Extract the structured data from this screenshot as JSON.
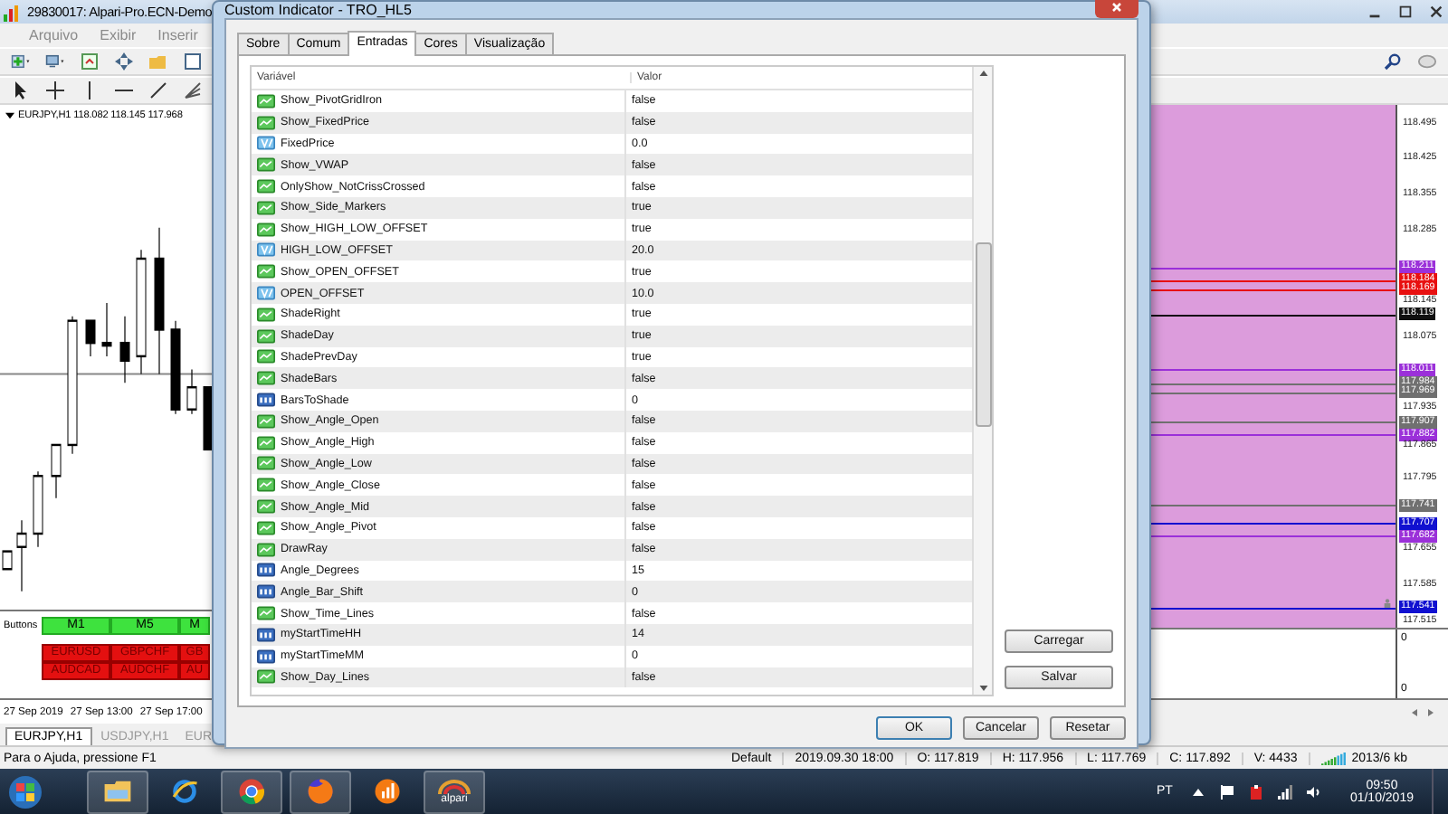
{
  "main_window": {
    "title": "29830017: Alpari-Pro.ECN-Demo",
    "menu": [
      "Arquivo",
      "Exibir",
      "Inserir"
    ]
  },
  "chart": {
    "label": "EURJPY,H1 118.082 118.145 117.968",
    "panel_label": "Buttons",
    "timeframe_buttons": [
      "M1",
      "M5",
      "M"
    ],
    "symbol_buttons": [
      "EURUSD",
      "GBPCHF",
      "GB",
      "AUDCAD",
      "AUDCHF",
      "AU"
    ],
    "time_labels": [
      "27 Sep 2019",
      "27 Sep 13:00",
      "27 Sep 17:00"
    ],
    "price_labels": [
      {
        "text": "118.495",
        "kind": "plain"
      },
      {
        "text": "118.425",
        "kind": "plain"
      },
      {
        "text": "118.355",
        "kind": "plain"
      },
      {
        "text": "118.285",
        "kind": "plain"
      },
      {
        "text": "118.211",
        "kind": "tag",
        "color": "#9b30d9"
      },
      {
        "text": "118.184",
        "kind": "tag",
        "color": "#e81010"
      },
      {
        "text": "118.169",
        "kind": "tag",
        "color": "#e81010"
      },
      {
        "text": "118.145",
        "kind": "plain"
      },
      {
        "text": "118.119",
        "kind": "tag",
        "color": "#101010"
      },
      {
        "text": "118.075",
        "kind": "plain"
      },
      {
        "text": "118.011",
        "kind": "tag",
        "color": "#9b30d9"
      },
      {
        "text": "117.984",
        "kind": "tag",
        "color": "#707070"
      },
      {
        "text": "117.969",
        "kind": "tag",
        "color": "#707070"
      },
      {
        "text": "117.935",
        "kind": "plain"
      },
      {
        "text": "117.907",
        "kind": "tag",
        "color": "#707070"
      },
      {
        "text": "117.882",
        "kind": "tag",
        "color": "#9b30d9"
      },
      {
        "text": "117.865",
        "kind": "plain"
      },
      {
        "text": "117.795",
        "kind": "plain"
      },
      {
        "text": "117.741",
        "kind": "tag",
        "color": "#707070"
      },
      {
        "text": "117.707",
        "kind": "tag",
        "color": "#1010d0"
      },
      {
        "text": "117.682",
        "kind": "tag",
        "color": "#9b30d9"
      },
      {
        "text": "117.655",
        "kind": "plain"
      },
      {
        "text": "117.585",
        "kind": "plain"
      },
      {
        "text": "117.541",
        "kind": "tag",
        "color": "#1010d0"
      },
      {
        "text": "117.515",
        "kind": "plain"
      }
    ],
    "subwindow_labels": [
      "0",
      "0"
    ]
  },
  "chart_tabs": [
    {
      "label": "EURJPY,H1",
      "selected": true
    },
    {
      "label": "USDJPY,H1",
      "selected": false
    },
    {
      "label": "EUR",
      "selected": false
    }
  ],
  "dialog": {
    "title": "Custom Indicator - TRO_HL5",
    "tabs": [
      {
        "label": "Sobre",
        "selected": false
      },
      {
        "label": "Comum",
        "selected": false
      },
      {
        "label": "Entradas",
        "selected": true
      },
      {
        "label": "Cores",
        "selected": false
      },
      {
        "label": "Visualização",
        "selected": false
      }
    ],
    "columns": [
      "Variável",
      "Valor"
    ],
    "rows": [
      {
        "kind": "bool",
        "name": "Show_PivotGridIron",
        "value": "false"
      },
      {
        "kind": "bool",
        "name": "Show_FixedPrice",
        "value": "false"
      },
      {
        "kind": "double",
        "name": "FixedPrice",
        "value": "0.0"
      },
      {
        "kind": "bool",
        "name": "Show_VWAP",
        "value": "false"
      },
      {
        "kind": "bool",
        "name": "OnlyShow_NotCrissCrossed",
        "value": "false"
      },
      {
        "kind": "bool",
        "name": "Show_Side_Markers",
        "value": "true"
      },
      {
        "kind": "bool",
        "name": "Show_HIGH_LOW_OFFSET",
        "value": "true"
      },
      {
        "kind": "double",
        "name": "HIGH_LOW_OFFSET",
        "value": "20.0"
      },
      {
        "kind": "bool",
        "name": "Show_OPEN_OFFSET",
        "value": "true"
      },
      {
        "kind": "double",
        "name": "OPEN_OFFSET",
        "value": "10.0"
      },
      {
        "kind": "bool",
        "name": "ShadeRight",
        "value": "true"
      },
      {
        "kind": "bool",
        "name": "ShadeDay",
        "value": "true"
      },
      {
        "kind": "bool",
        "name": "ShadePrevDay",
        "value": "true"
      },
      {
        "kind": "bool",
        "name": "ShadeBars",
        "value": "false"
      },
      {
        "kind": "int",
        "name": "BarsToShade",
        "value": "0"
      },
      {
        "kind": "bool",
        "name": "Show_Angle_Open",
        "value": "false"
      },
      {
        "kind": "bool",
        "name": "Show_Angle_High",
        "value": "false"
      },
      {
        "kind": "bool",
        "name": "Show_Angle_Low",
        "value": "false"
      },
      {
        "kind": "bool",
        "name": "Show_Angle_Close",
        "value": "false"
      },
      {
        "kind": "bool",
        "name": "Show_Angle_Mid",
        "value": "false"
      },
      {
        "kind": "bool",
        "name": "Show_Angle_Pivot",
        "value": "false"
      },
      {
        "kind": "bool",
        "name": "DrawRay",
        "value": "false"
      },
      {
        "kind": "int",
        "name": "Angle_Degrees",
        "value": "15"
      },
      {
        "kind": "int",
        "name": "Angle_Bar_Shift",
        "value": "0"
      },
      {
        "kind": "bool",
        "name": "Show_Time_Lines",
        "value": "false"
      },
      {
        "kind": "int",
        "name": "myStartTimeHH",
        "value": "14"
      },
      {
        "kind": "int",
        "name": "myStartTimeMM",
        "value": "0"
      },
      {
        "kind": "bool",
        "name": "Show_Day_Lines",
        "value": "false"
      }
    ],
    "side_buttons": [
      "Carregar",
      "Salvar"
    ],
    "buttons": [
      "OK",
      "Cancelar",
      "Resetar"
    ]
  },
  "status_bar": {
    "help": "Para o Ajuda, pressione F1",
    "fields": [
      "Default",
      "2019.09.30 18:00",
      "O: 117.819",
      "H: 117.956",
      "L: 117.769",
      "C: 117.892",
      "V: 4433"
    ],
    "traffic": "2013/6 kb"
  },
  "taskbar": {
    "app_label": "alpari",
    "language": "PT",
    "time": "09:50",
    "date": "01/10/2019"
  }
}
